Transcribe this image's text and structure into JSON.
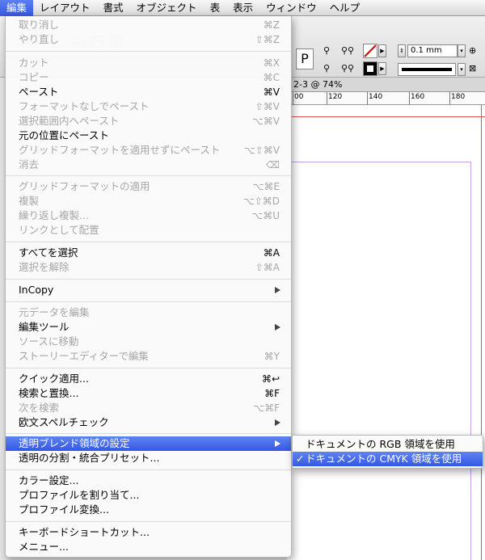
{
  "menubar": {
    "items": [
      "編集",
      "レイアウト",
      "書式",
      "オブジェクト",
      "表",
      "表示",
      "ウィンドウ",
      "ヘルプ"
    ]
  },
  "document": {
    "tab_title": "2-3 @ 74%",
    "ruler_labels": [
      "00",
      "120",
      "140",
      "160",
      "180"
    ],
    "stroke_weight": "0.1 mm",
    "style_letter": "P"
  },
  "edit_menu": {
    "items": [
      {
        "label": "取り消し",
        "shortcut": "⌘Z",
        "disabled": true
      },
      {
        "label": "やり直し",
        "shortcut": "⇧⌘Z",
        "disabled": true
      },
      {
        "label": "カット",
        "shortcut": "⌘X",
        "disabled": true
      },
      {
        "label": "コピー",
        "shortcut": "⌘C",
        "disabled": true
      },
      {
        "label": "ペースト",
        "shortcut": "⌘V",
        "disabled": false
      },
      {
        "label": "フォーマットなしでペースト",
        "shortcut": "⇧⌘V",
        "disabled": true
      },
      {
        "label": "選択範囲内へペースト",
        "shortcut": "⌥⌘V",
        "disabled": true
      },
      {
        "label": "元の位置にペースト",
        "shortcut": "",
        "disabled": false
      },
      {
        "label": "グリッドフォーマットを適用せずにペースト",
        "shortcut": "⌥⇧⌘V",
        "disabled": true
      },
      {
        "label": "消去",
        "shortcut": "⌫",
        "disabled": true
      },
      {
        "label": "グリッドフォーマットの適用",
        "shortcut": "⌥⌘E",
        "disabled": true
      },
      {
        "label": "複製",
        "shortcut": "⌥⇧⌘D",
        "disabled": true
      },
      {
        "label": "繰り返し複製...",
        "shortcut": "⌥⌘U",
        "disabled": true
      },
      {
        "label": "リンクとして配置",
        "shortcut": "",
        "disabled": true
      },
      {
        "label": "すべてを選択",
        "shortcut": "⌘A",
        "disabled": false
      },
      {
        "label": "選択を解除",
        "shortcut": "⇧⌘A",
        "disabled": true
      },
      {
        "label": "InCopy",
        "shortcut": "",
        "disabled": false,
        "submenu": true
      },
      {
        "label": "元データを編集",
        "shortcut": "",
        "disabled": true
      },
      {
        "label": "編集ツール",
        "shortcut": "",
        "disabled": false,
        "submenu": true
      },
      {
        "label": "ソースに移動",
        "shortcut": "",
        "disabled": true
      },
      {
        "label": "ストーリーエディターで編集",
        "shortcut": "⌘Y",
        "disabled": true
      },
      {
        "label": "クイック適用...",
        "shortcut": "⌘↩",
        "disabled": false
      },
      {
        "label": "検索と置換...",
        "shortcut": "⌘F",
        "disabled": false
      },
      {
        "label": "次を検索",
        "shortcut": "⌥⌘F",
        "disabled": true
      },
      {
        "label": "欧文スペルチェック",
        "shortcut": "",
        "disabled": false,
        "submenu": true
      },
      {
        "label": "透明ブレンド領域の設定",
        "shortcut": "",
        "disabled": false,
        "submenu": true,
        "active": true
      },
      {
        "label": "透明の分割・統合プリセット...",
        "shortcut": "",
        "disabled": false
      },
      {
        "label": "カラー設定...",
        "shortcut": "",
        "disabled": false
      },
      {
        "label": "プロファイルを割り当て...",
        "shortcut": "",
        "disabled": false
      },
      {
        "label": "プロファイル変換...",
        "shortcut": "",
        "disabled": false
      },
      {
        "label": "キーボードショートカット...",
        "shortcut": "",
        "disabled": false
      },
      {
        "label": "メニュー...",
        "shortcut": "",
        "disabled": false
      }
    ]
  },
  "blend_submenu": {
    "items": [
      {
        "label": "ドキュメントの RGB 領域を使用",
        "checked": false
      },
      {
        "label": "ドキュメントの CMYK 領域を使用",
        "checked": true
      }
    ],
    "check_mark": "✓"
  },
  "colors": {
    "highlight": "#3f63e8",
    "disabled_text": "#a6a6a6"
  }
}
